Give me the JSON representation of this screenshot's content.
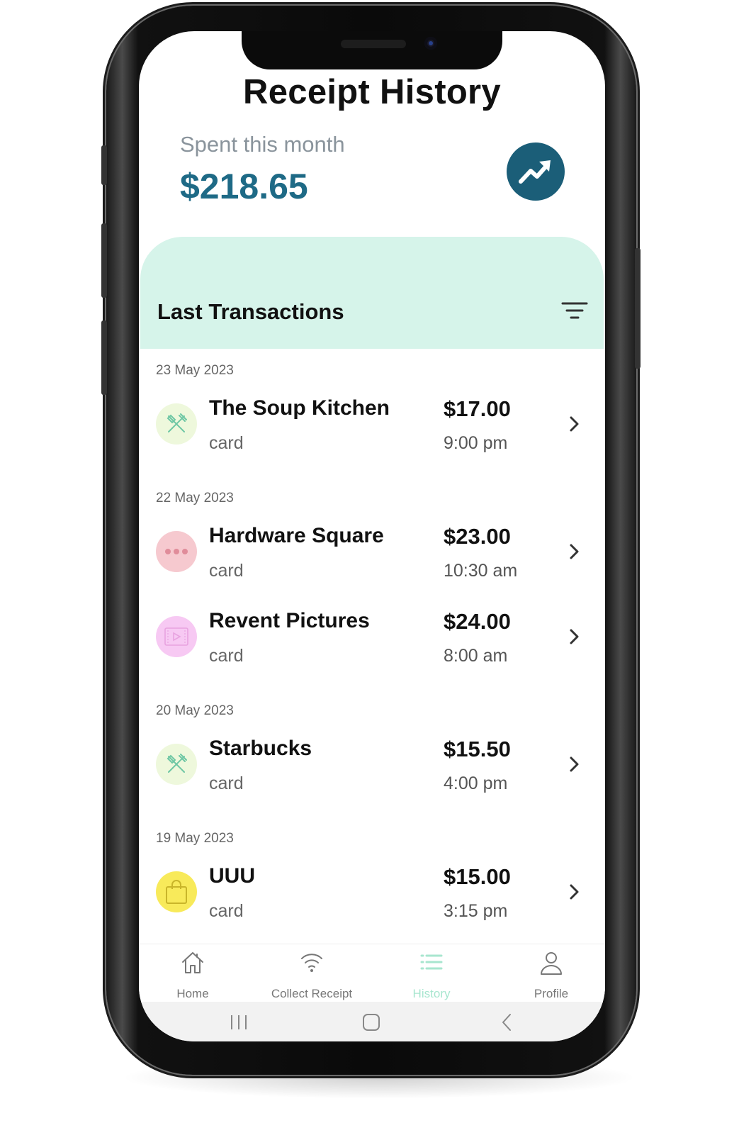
{
  "header": {
    "title": "Receipt History",
    "spent_label": "Spent this month",
    "spent_amount": "$218.65",
    "trend_icon": "trending-up-icon"
  },
  "transactions": {
    "title": "Last Transactions",
    "filter_icon": "filter-icon",
    "groups": [
      {
        "date": "23 May 2023",
        "items": [
          {
            "name": "The Soup Kitchen",
            "method": "card",
            "amount": "$17.00",
            "time": "9:00 pm",
            "icon": "restaurant-icon"
          }
        ]
      },
      {
        "date": "22 May 2023",
        "items": [
          {
            "name": "Hardware Square",
            "method": "card",
            "amount": "$23.00",
            "time": "10:30 am",
            "icon": "more-icon"
          },
          {
            "name": "Revent Pictures",
            "method": "card",
            "amount": "$24.00",
            "time": "8:00 am",
            "icon": "movie-icon"
          }
        ]
      },
      {
        "date": "20 May 2023",
        "items": [
          {
            "name": "Starbucks",
            "method": "card",
            "amount": "$15.50",
            "time": "4:00 pm",
            "icon": "restaurant-icon"
          }
        ]
      },
      {
        "date": "19 May 2023",
        "items": [
          {
            "name": "UUU",
            "method": "card",
            "amount": "$15.00",
            "time": "3:15 pm",
            "icon": "shopping-bag-icon"
          }
        ]
      }
    ]
  },
  "bottom_nav": {
    "items": [
      {
        "label": "Home",
        "icon": "home-icon",
        "active": false
      },
      {
        "label": "Collect Receipt",
        "icon": "wifi-icon",
        "active": false
      },
      {
        "label": "History",
        "icon": "list-icon",
        "active": true
      },
      {
        "label": "Profile",
        "icon": "user-icon",
        "active": false
      }
    ]
  },
  "colors": {
    "accent": "#1e6a86",
    "trend_button": "#1b5e78",
    "header_band": "#d6f4ea",
    "nav_active": "#a8e6cf",
    "food_icon_bg": "#eef8dc",
    "misc_icon_bg": "#f6c9cf",
    "movie_icon_bg": "#f7c9f3",
    "shopping_icon_bg": "#f8ea5a"
  }
}
